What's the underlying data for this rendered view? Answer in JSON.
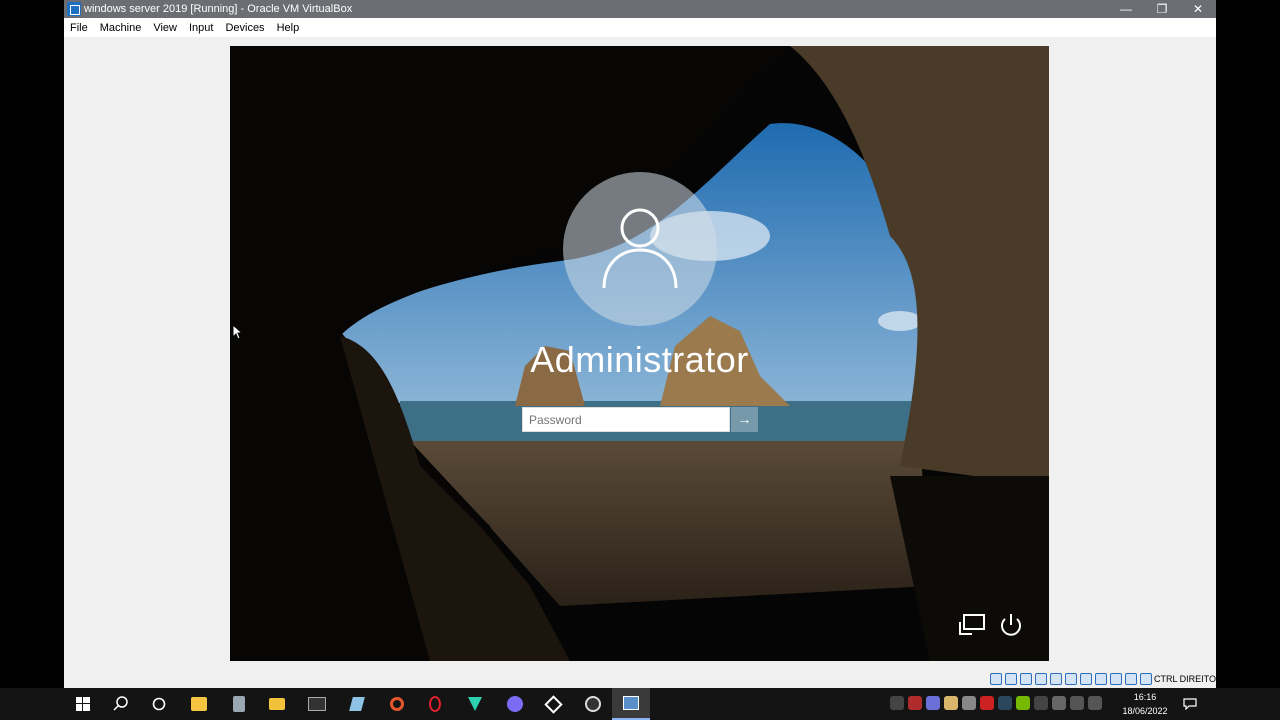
{
  "window": {
    "title": "windows server 2019 [Running] - Oracle VM VirtualBox",
    "minimize": "—",
    "restore": "❐",
    "close": "✕"
  },
  "menu": [
    "File",
    "Machine",
    "View",
    "Input",
    "Devices",
    "Help"
  ],
  "login": {
    "username": "Administrator",
    "password_placeholder": "Password",
    "submit_glyph": "→"
  },
  "statusbar": {
    "host_key": "CTRL DIREITO"
  },
  "taskbar": {
    "time": "16:16",
    "date": "18/06/2022"
  }
}
